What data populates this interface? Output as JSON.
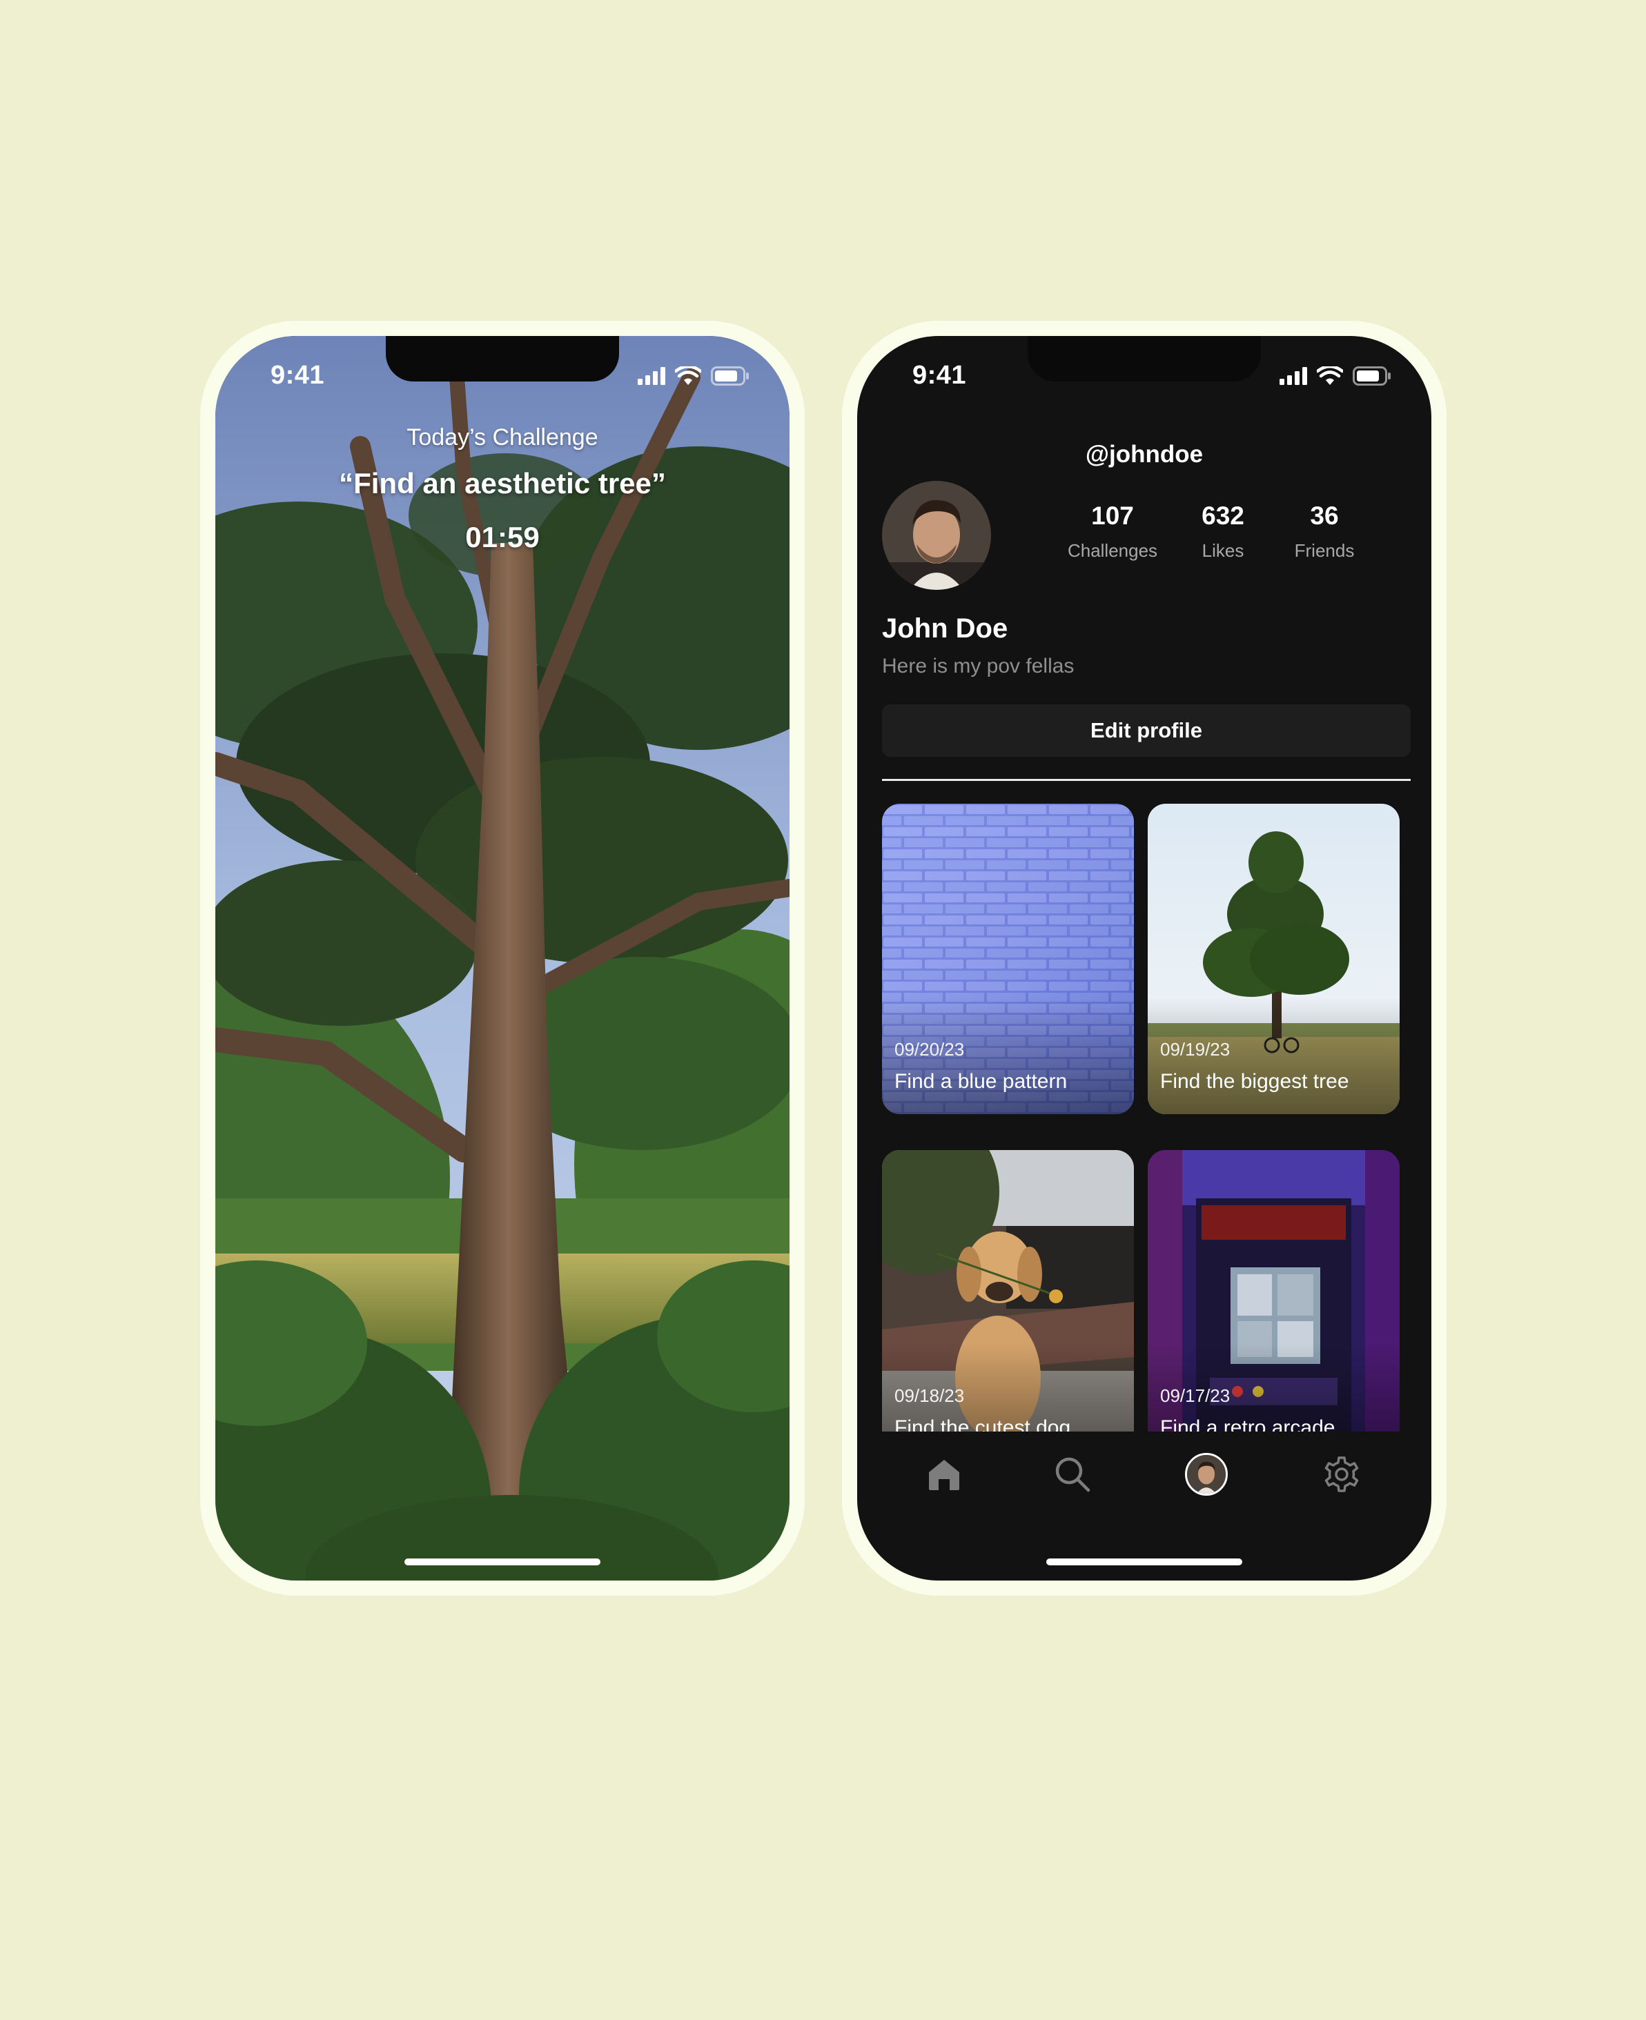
{
  "status_bar": {
    "time": "9:41"
  },
  "camera_screen": {
    "challenge_label": "Today’s Challenge",
    "challenge_title": "“Find an aesthetic tree”",
    "timer": "01:59",
    "controls": {
      "flash_icon": "flash-icon",
      "shutter": "shutter-button",
      "flip_icon": "flip-camera-icon"
    }
  },
  "profile_screen": {
    "username": "@johndoe",
    "stats": [
      {
        "value": "107",
        "label": "Challenges"
      },
      {
        "value": "632",
        "label": "Likes"
      },
      {
        "value": "36",
        "label": "Friends"
      }
    ],
    "name": "John Doe",
    "bio": "Here is my pov fellas",
    "edit_button": "Edit profile",
    "posts": [
      {
        "date": "09/20/23",
        "title": "Find a blue pattern"
      },
      {
        "date": "09/19/23",
        "title": "Find the biggest tree"
      },
      {
        "date": "09/18/23",
        "title": "Find the cutest dog"
      },
      {
        "date": "09/17/23",
        "title": "Find a retro arcade"
      }
    ],
    "tabbar": [
      "home-icon",
      "search-icon",
      "profile-avatar",
      "settings-icon"
    ]
  },
  "colors": {
    "background": "#eff0d0",
    "phone_frame": "#fbfdeb",
    "profile_bg": "#121212",
    "text_muted": "#a8a8a8"
  }
}
